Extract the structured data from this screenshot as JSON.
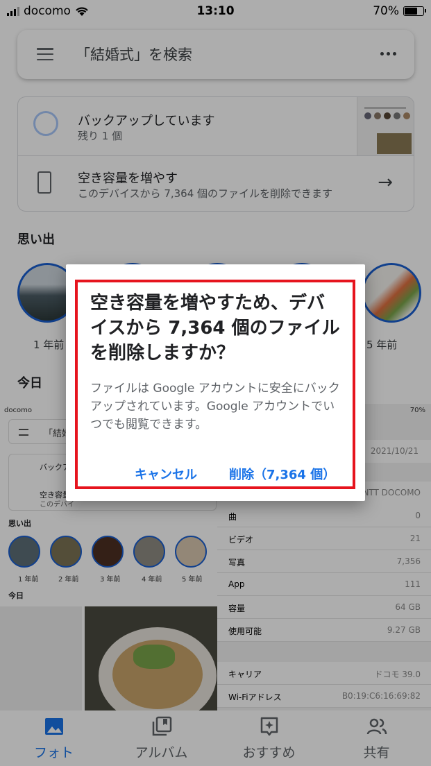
{
  "status_bar": {
    "carrier": "docomo",
    "time": "13:10",
    "battery": "70%"
  },
  "search": {
    "placeholder": "「結婚式」を検索"
  },
  "backup_card": {
    "title": "バックアップしています",
    "subtitle": "残り 1 個",
    "free_space_title": "空き容量を増やす",
    "free_space_subtitle": "このデバイスから 7,364 個のファイルを削除できます"
  },
  "memories": {
    "title": "思い出",
    "items": [
      {
        "label": "1 年前"
      },
      {
        "label": ""
      },
      {
        "label": ""
      },
      {
        "label": ""
      },
      {
        "label": "5 年前"
      }
    ]
  },
  "today": {
    "title": "今日"
  },
  "embedded_screenshot": {
    "status_carrier": "docomo",
    "status_battery": "70%",
    "search_text": "「結婚式",
    "backup_text": "バックア",
    "free_text": "空き容量",
    "free_sub": "このデバイ",
    "memories_title": "思い出",
    "memory_labels": [
      "1 年前",
      "2 年前",
      "3 年前",
      "4 年前",
      "5 年前"
    ],
    "today_title": "今日",
    "date": "2021/10/21",
    "network": "NTT DOCOMO",
    "rows": [
      {
        "key": "曲",
        "value": "0"
      },
      {
        "key": "ビデオ",
        "value": "21"
      },
      {
        "key": "写真",
        "value": "7,356"
      },
      {
        "key": "App",
        "value": "111"
      },
      {
        "key": "容量",
        "value": "64 GB"
      },
      {
        "key": "使用可能",
        "value": "9.27 GB"
      }
    ],
    "rows2": [
      {
        "key": "キャリア",
        "value": "ドコモ 39.0"
      },
      {
        "key": "Wi-Fiアドレス",
        "value": "B0:19:C6:16:69:82"
      }
    ]
  },
  "dialog": {
    "title": "空き容量を増やすため、デバイスから 7,364 個のファイルを削除しますか？",
    "body": "ファイルは Google アカウントに安全にバックアップされています。Google アカウントでいつでも閲覧できます。",
    "cancel_label": "キャンセル",
    "delete_label": "削除（7,364 個）"
  },
  "nav": {
    "items": [
      {
        "label": "フォト",
        "icon": "photo-icon"
      },
      {
        "label": "アルバム",
        "icon": "album-icon"
      },
      {
        "label": "おすすめ",
        "icon": "for-you-icon"
      },
      {
        "label": "共有",
        "icon": "sharing-icon"
      }
    ]
  },
  "colors": {
    "accent": "#1a73e8",
    "highlight_frame": "#e6141e",
    "memory_ring": "#1a5fd0"
  }
}
